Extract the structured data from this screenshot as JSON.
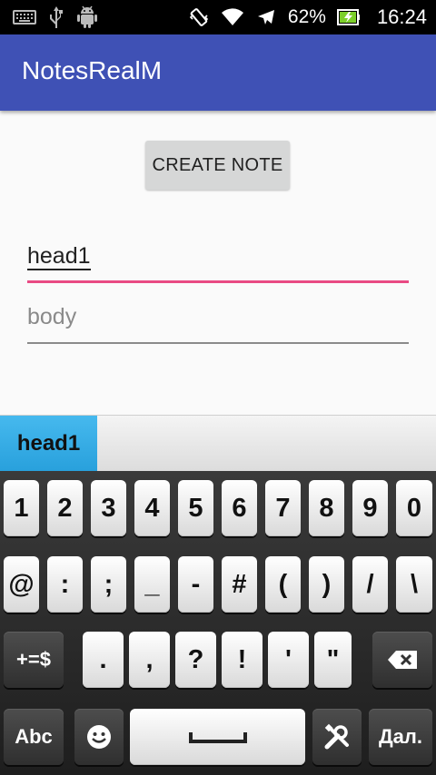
{
  "status_bar": {
    "battery_percent": "62%",
    "time": "16:24",
    "icons": [
      "keyboard-icon",
      "usb-icon",
      "android-icon",
      "vibrate-icon",
      "wifi-icon",
      "airplane-icon",
      "battery-charging-icon"
    ]
  },
  "app_bar": {
    "title": "NotesRealM"
  },
  "main": {
    "create_button_label": "CREATE NOTE",
    "head_value": "head1",
    "body_placeholder": "body"
  },
  "colors": {
    "primary": "#3f51b5",
    "accent": "#e94a83",
    "suggestion": "#33a9e4"
  },
  "suggestion_bar": {
    "suggestion": "head1"
  },
  "keyboard": {
    "row1": [
      "1",
      "2",
      "3",
      "4",
      "5",
      "6",
      "7",
      "8",
      "9",
      "0"
    ],
    "row2": [
      "@",
      ":",
      ";",
      "_",
      "-",
      "#",
      "(",
      ")",
      "/",
      "\\"
    ],
    "row3_left": "+=$",
    "row3": [
      ".",
      ",",
      "?",
      "!",
      "'",
      "\""
    ],
    "row4_left": "Abc",
    "row4_right": "Дал.",
    "icons": [
      "backspace-icon",
      "emoji-icon",
      "space-bar-icon",
      "tools-icon"
    ]
  }
}
